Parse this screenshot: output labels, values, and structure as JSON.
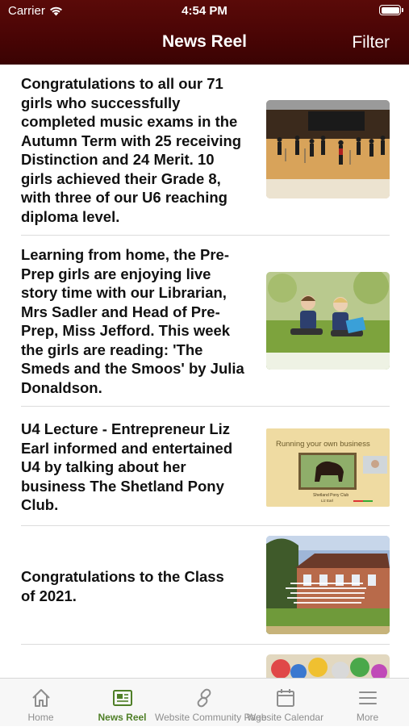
{
  "status_bar": {
    "carrier": "Carrier",
    "time": "4:54 PM"
  },
  "nav": {
    "title": "News Reel",
    "filter_label": "Filter"
  },
  "feed": [
    {
      "text": " Congratulations to all our 71\ngirls who successfully\ncompleted music exams in the\nAutumn Term with 25 receiving\nDistinction and 24 Merit. 10\ngirls achieved their Grade 8,\nwith three of our U6 reaching\ndiploma level.",
      "image": "orchestra-concert-photo"
    },
    {
      "text": "Learning from home, the Pre-\nPrep girls are enjoying live\nstory time with our Librarian,\nMrs Sadler and Head of Pre-\nPrep, Miss Jefford. This week\nthe girls are reading: 'The\nSmeds and the Smoos' by Julia\nDonaldson.",
      "image": "children-reading-photo"
    },
    {
      "text": "U4 Lecture - Entrepreneur Liz\nEarl informed and entertained\nU4 by talking about her\nbusiness The Shetland Pony\nClub.",
      "image": "lecture-slide-image",
      "slide": {
        "heading": "Running your own business",
        "caption": "Shetland Pony Club",
        "presenter": "Liz Earl"
      }
    },
    {
      "text": " Congratulations to the Class\nof 2021.",
      "image": "school-building-photo"
    },
    {
      "text": "",
      "image": "colorful-artwork-photo"
    }
  ],
  "tabs": [
    {
      "label": "Home",
      "icon": "home-icon",
      "active": false
    },
    {
      "label": "News Reel",
      "icon": "newspaper-icon",
      "active": true
    },
    {
      "label": "Website Community Page",
      "icon": "link-icon",
      "active": false
    },
    {
      "label": "Website Calendar",
      "icon": "calendar-icon",
      "active": false
    },
    {
      "label": "More",
      "icon": "menu-icon",
      "active": false
    }
  ],
  "colors": {
    "header": "#4a0505",
    "active_tab": "#4f7f27",
    "inactive_tab": "#8e8e8e"
  }
}
